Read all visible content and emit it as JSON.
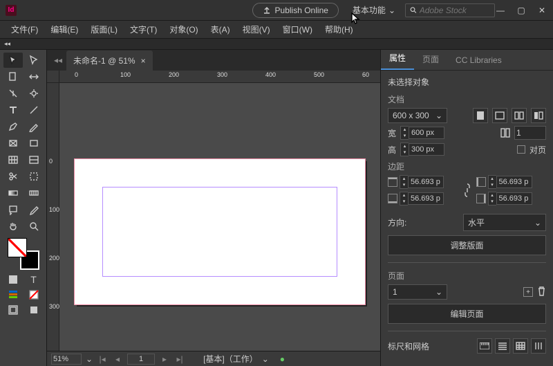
{
  "title_bar": {
    "publish_label": "Publish Online",
    "workspace_label": "基本功能",
    "search_placeholder": "Adobe Stock"
  },
  "menu": [
    "文件(F)",
    "编辑(E)",
    "版面(L)",
    "文字(T)",
    "对象(O)",
    "表(A)",
    "视图(V)",
    "窗口(W)",
    "帮助(H)"
  ],
  "document_tab": {
    "label": "未命名-1 @ 51%"
  },
  "ruler_h": [
    "0",
    "100",
    "200",
    "300",
    "400",
    "500",
    "60"
  ],
  "ruler_v": [
    "0",
    "100",
    "200",
    "300"
  ],
  "status": {
    "zoom": "51%",
    "page": "1",
    "master": "[基本]（工作）"
  },
  "panels": {
    "tabs": [
      "属性",
      "页面",
      "CC Libraries"
    ],
    "active": 0
  },
  "properties": {
    "selection_info": "未选择对象",
    "doc_section": "文档",
    "preset": "600 x 300",
    "width_label": "宽",
    "width": "600 px",
    "height_label": "高",
    "height": "300 px",
    "columns": "1",
    "facing_label": "对页",
    "margins_section": "边距",
    "m_top": "56.693 p",
    "m_bottom": "56.693 p",
    "m_left": "56.693 p",
    "m_right": "56.693 p",
    "orient_label": "方向:",
    "orient_value": "水平",
    "adjust_btn": "调整版面",
    "page_section": "页面",
    "page_num": "1",
    "edit_page_btn": "编辑页面",
    "ruler_grid_section": "标尺和网格"
  }
}
